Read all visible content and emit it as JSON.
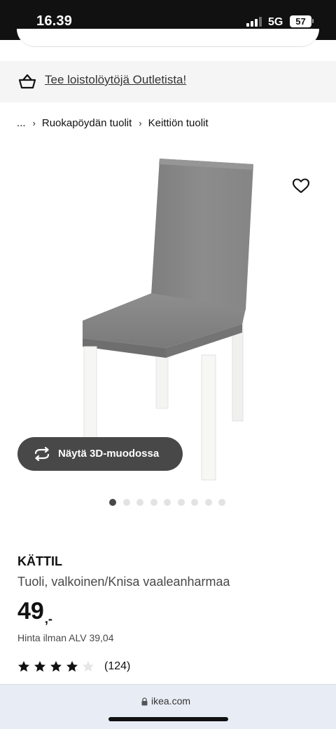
{
  "status_bar": {
    "time": "16.39",
    "network": "5G",
    "battery": "57"
  },
  "outlet_banner": {
    "icon": "basket-icon",
    "link_text": "Tee loistolöytöjä Outletista!"
  },
  "breadcrumb": {
    "items": [
      "...",
      "Ruokapöydän tuolit",
      "Keittiön tuolit"
    ]
  },
  "gallery": {
    "view_3d_label": "Näytä 3D-muodossa",
    "image_count": 9,
    "active_index": 0
  },
  "product": {
    "name": "KÄTTIL",
    "description": "Tuoli, valkoinen/Knisa vaaleanharmaa",
    "price": "49",
    "price_suffix": ",-",
    "vat_text": "Hinta ilman ALV 39,04",
    "rating": 4,
    "rating_max": 5,
    "review_count": "(124)"
  },
  "browser": {
    "url": "ikea.com"
  },
  "colors": {
    "button_bg": "#484848",
    "banner_bg": "#f5f5f5",
    "url_bar_bg": "#e8edf5",
    "chair_fabric": "#8a8a8a"
  }
}
